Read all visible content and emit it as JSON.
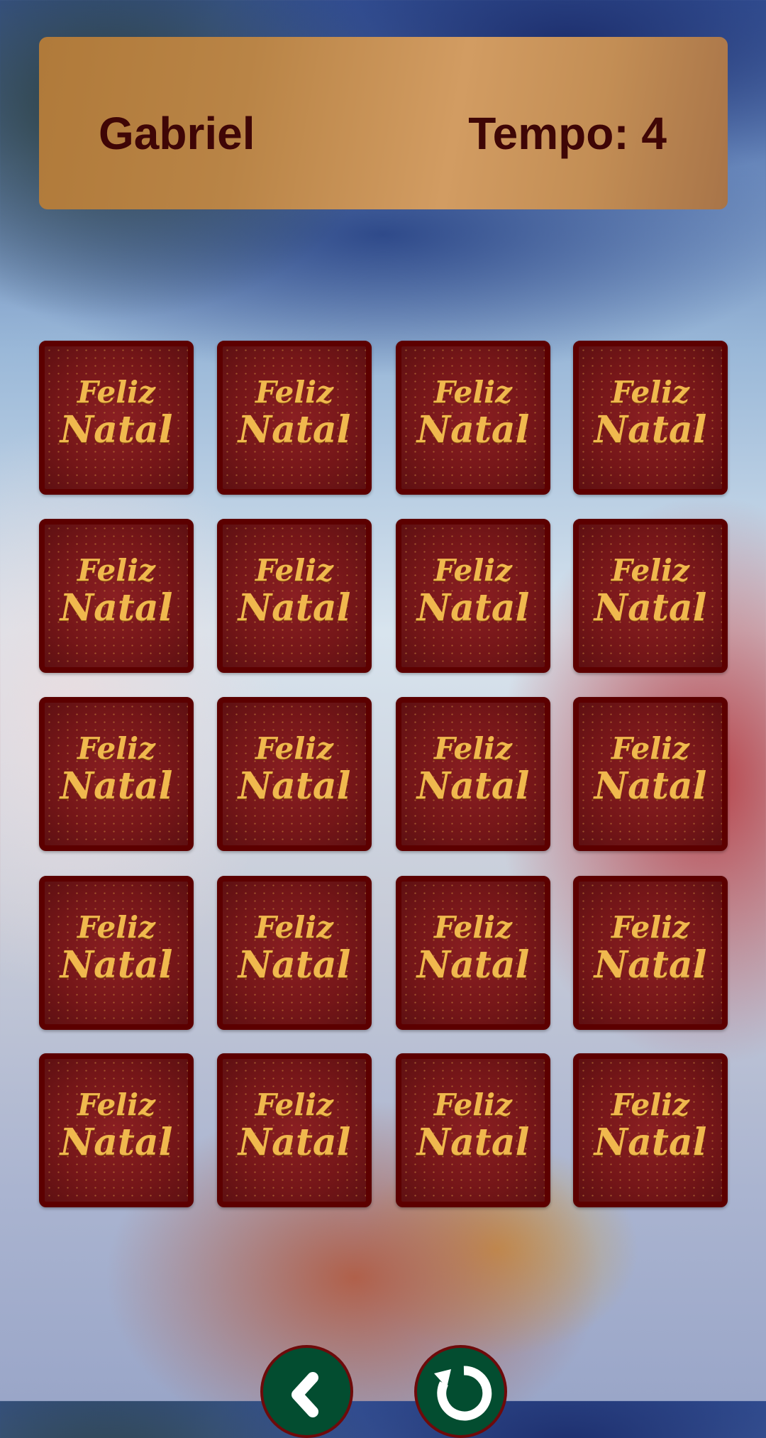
{
  "header": {
    "player_name": "Gabriel",
    "time_label": "Tempo: 4"
  },
  "cards": [
    {
      "line1": "Feliz",
      "line2": "Natal"
    },
    {
      "line1": "Feliz",
      "line2": "Natal"
    },
    {
      "line1": "Feliz",
      "line2": "Natal"
    },
    {
      "line1": "Feliz",
      "line2": "Natal"
    },
    {
      "line1": "Feliz",
      "line2": "Natal"
    },
    {
      "line1": "Feliz",
      "line2": "Natal"
    },
    {
      "line1": "Feliz",
      "line2": "Natal"
    },
    {
      "line1": "Feliz",
      "line2": "Natal"
    },
    {
      "line1": "Feliz",
      "line2": "Natal"
    },
    {
      "line1": "Feliz",
      "line2": "Natal"
    },
    {
      "line1": "Feliz",
      "line2": "Natal"
    },
    {
      "line1": "Feliz",
      "line2": "Natal"
    },
    {
      "line1": "Feliz",
      "line2": "Natal"
    },
    {
      "line1": "Feliz",
      "line2": "Natal"
    },
    {
      "line1": "Feliz",
      "line2": "Natal"
    },
    {
      "line1": "Feliz",
      "line2": "Natal"
    },
    {
      "line1": "Feliz",
      "line2": "Natal"
    },
    {
      "line1": "Feliz",
      "line2": "Natal"
    },
    {
      "line1": "Feliz",
      "line2": "Natal"
    },
    {
      "line1": "Feliz",
      "line2": "Natal"
    }
  ],
  "buttons": {
    "back_icon": "chevron-left-icon",
    "restart_icon": "restart-icon"
  },
  "colors": {
    "card_border": "#5c0000",
    "card_face": "#7a1a1c",
    "button_bg": "#034d30",
    "button_border": "#6e0a0a",
    "text": "#3f0606"
  }
}
